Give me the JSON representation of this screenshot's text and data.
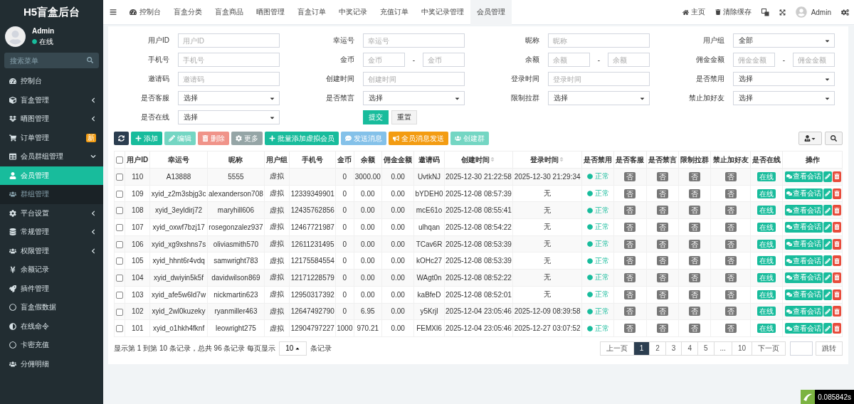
{
  "sidebar": {
    "brand": "H5盲盒后台",
    "user": {
      "name": "Admin",
      "status": "在线"
    },
    "search": {
      "placeholder": "搜索菜单"
    },
    "items": [
      {
        "label": "控制台",
        "selected": false
      },
      {
        "label": "盲盒管理",
        "selected": false,
        "expanded": false
      },
      {
        "label": "晒图管理",
        "selected": false,
        "expanded": false
      },
      {
        "label": "订单管理",
        "selected": false,
        "badge": "新"
      },
      {
        "label": "会员群组管理",
        "selected": false,
        "expanded": true,
        "children": [
          {
            "label": "会员管理",
            "selected": true
          },
          {
            "label": "群组管理",
            "selected": false
          }
        ]
      },
      {
        "label": "平台设置",
        "selected": false,
        "expanded": false
      },
      {
        "label": "常规管理",
        "selected": false,
        "expanded": false
      },
      {
        "label": "权限管理",
        "selected": false,
        "expanded": false
      },
      {
        "label": "余额记录",
        "selected": false
      },
      {
        "label": "插件管理",
        "selected": false
      },
      {
        "label": "盲盒假数据",
        "selected": false
      },
      {
        "label": "在线命令",
        "selected": false
      },
      {
        "label": "卡密充值",
        "selected": false
      },
      {
        "label": "分佣明细",
        "selected": false
      }
    ]
  },
  "topbar": {
    "tabs": [
      {
        "label": "控制台",
        "selected": false
      },
      {
        "label": "盲盒分类",
        "selected": false
      },
      {
        "label": "盲盒商品",
        "selected": false
      },
      {
        "label": "晒图管理",
        "selected": false
      },
      {
        "label": "盲盒订单",
        "selected": false
      },
      {
        "label": "中奖记录",
        "selected": false
      },
      {
        "label": "充值订单",
        "selected": false
      },
      {
        "label": "中奖记录管理",
        "selected": false
      },
      {
        "label": "会员管理",
        "selected": true
      }
    ],
    "links": [
      "主页",
      "清除缓存"
    ],
    "user": "Admin"
  },
  "filters": [
    {
      "label": "用户ID",
      "kind": "text",
      "placeholder": "用户ID"
    },
    {
      "label": "幸运号",
      "kind": "text",
      "placeholder": "幸运号"
    },
    {
      "label": "昵称",
      "kind": "text",
      "placeholder": "昵称"
    },
    {
      "label": "用户组",
      "kind": "select",
      "value": "全部"
    },
    {
      "label": "手机号",
      "kind": "text",
      "placeholder": "手机号"
    },
    {
      "label": "金币",
      "kind": "range",
      "placeholder": "金币",
      "placeholder_to": "金币",
      "separator": "-"
    },
    {
      "label": "余额",
      "kind": "range",
      "placeholder": "余额",
      "placeholder_to": "余额",
      "separator": "-"
    },
    {
      "label": "佣金金额",
      "kind": "range",
      "placeholder": "佣金金额",
      "placeholder_to": "佣金金额",
      "separator": "-"
    },
    {
      "label": "邀请码",
      "kind": "text",
      "placeholder": "邀请码"
    },
    {
      "label": "创建时间",
      "kind": "text",
      "placeholder": "创建时间"
    },
    {
      "label": "登录时间",
      "kind": "text",
      "placeholder": "登录时间"
    },
    {
      "label": "是否禁用",
      "kind": "select",
      "value": "选择"
    },
    {
      "label": "是否客服",
      "kind": "select",
      "value": "选择"
    },
    {
      "label": "是否禁言",
      "kind": "select",
      "value": "选择"
    },
    {
      "label": "限制拉群",
      "kind": "select",
      "value": "选择"
    },
    {
      "label": "禁止加好友",
      "kind": "select",
      "value": "选择"
    },
    {
      "label": "是否在线",
      "kind": "select",
      "value": "选择"
    }
  ],
  "form_buttons": [
    "提交",
    "重置"
  ],
  "toolbar": [
    {
      "kind": "dark",
      "disabled": false
    },
    {
      "label": "添加",
      "kind": "success",
      "disabled": false
    },
    {
      "label": "编辑",
      "kind": "success",
      "disabled": true
    },
    {
      "label": "删除",
      "kind": "danger",
      "disabled": true
    },
    {
      "label": "更多",
      "kind": "muted",
      "disabled": false
    },
    {
      "label": "批量添加虚拟会员",
      "kind": "success",
      "disabled": false
    },
    {
      "label": "发送消息",
      "kind": "info",
      "disabled": true
    },
    {
      "label": "全员消息发送",
      "kind": "warning",
      "disabled": false
    },
    {
      "label": "创建群",
      "kind": "success",
      "disabled": true
    }
  ],
  "table": {
    "select_all_checked": false,
    "columns": [
      {
        "label": "用户ID",
        "sortable": false
      },
      {
        "label": "幸运号",
        "sortable": false
      },
      {
        "label": "昵称",
        "sortable": false
      },
      {
        "label": "用户组",
        "sortable": false
      },
      {
        "label": "手机号",
        "sortable": false
      },
      {
        "label": "金币",
        "sortable": false
      },
      {
        "label": "余额",
        "sortable": false
      },
      {
        "label": "佣金金额",
        "sortable": false
      },
      {
        "label": "邀请码",
        "sortable": false
      },
      {
        "label": "创建时间",
        "sortable": true
      },
      {
        "label": "登录时间",
        "sortable": true
      },
      {
        "label": "是否禁用",
        "sortable": false
      },
      {
        "label": "是否客服",
        "sortable": false
      },
      {
        "label": "是否禁言",
        "sortable": false
      },
      {
        "label": "限制拉群",
        "sortable": false
      },
      {
        "label": "禁止加好友",
        "sortable": false
      },
      {
        "label": "是否在线",
        "sortable": false
      },
      {
        "label": "操作",
        "sortable": false
      }
    ],
    "rows": [
      {
        "checked": false,
        "cells": [
          "110",
          "A13888",
          "5555",
          "虚拟",
          "",
          "0",
          "3000.00",
          "0.00",
          "UvtkNJ",
          "2025-12-30 21:22:58",
          "2025-12-30 21:29:34"
        ],
        "status": "正常",
        "flags": [
          "否",
          "否",
          "否",
          "否"
        ],
        "online": "在线",
        "action": "查看会话"
      },
      {
        "checked": false,
        "cells": [
          "109",
          "xyid_z2m3sbjg3c",
          "alexanderson708",
          "虚拟",
          "12339349901",
          "0",
          "0.00",
          "0.00",
          "bYDEH0",
          "2025-12-08 08:57:39",
          "无"
        ],
        "status": "正常",
        "flags": [
          "否",
          "否",
          "否",
          "否"
        ],
        "online": "在线",
        "action": "查看会话"
      },
      {
        "checked": false,
        "cells": [
          "108",
          "xyid_3eyldirj72",
          "maryhill606",
          "虚拟",
          "12435762856",
          "0",
          "0.00",
          "0.00",
          "mcE61o",
          "2025-12-08 08:55:41",
          "无"
        ],
        "status": "正常",
        "flags": [
          "否",
          "否",
          "否",
          "否"
        ],
        "online": "在线",
        "action": "查看会话"
      },
      {
        "checked": false,
        "cells": [
          "107",
          "xyid_oxwf7bzj17",
          "rosegonzalez937",
          "虚拟",
          "12467721987",
          "0",
          "0.00",
          "0.00",
          "ulhqan",
          "2025-12-08 08:54:22",
          "无"
        ],
        "status": "正常",
        "flags": [
          "否",
          "否",
          "否",
          "否"
        ],
        "online": "在线",
        "action": "查看会话"
      },
      {
        "checked": false,
        "cells": [
          "106",
          "xyid_xg9xshns7s",
          "oliviasmith570",
          "虚拟",
          "12611231495",
          "0",
          "0.00",
          "0.00",
          "TCav6R",
          "2025-12-08 08:53:39",
          "无"
        ],
        "status": "正常",
        "flags": [
          "否",
          "否",
          "否",
          "否"
        ],
        "online": "在线",
        "action": "查看会话"
      },
      {
        "checked": false,
        "cells": [
          "105",
          "xyid_hhnt6r4vdq",
          "samwright783",
          "虚拟",
          "12175584554",
          "0",
          "0.00",
          "0.00",
          "kOHc27",
          "2025-12-08 08:53:39",
          "无"
        ],
        "status": "正常",
        "flags": [
          "否",
          "否",
          "否",
          "否"
        ],
        "online": "在线",
        "action": "查看会话"
      },
      {
        "checked": false,
        "cells": [
          "104",
          "xyid_dwiyin5k5f",
          "davidwilson869",
          "虚拟",
          "12171228579",
          "0",
          "0.00",
          "0.00",
          "WAgt0n",
          "2025-12-08 08:52:22",
          "无"
        ],
        "status": "正常",
        "flags": [
          "否",
          "否",
          "否",
          "否"
        ],
        "online": "在线",
        "action": "查看会话"
      },
      {
        "checked": false,
        "cells": [
          "103",
          "xyid_afe5w6ld7w",
          "nickmartin623",
          "虚拟",
          "12950317392",
          "0",
          "0.00",
          "0.00",
          "kaBfeD",
          "2025-12-08 08:52:01",
          "无"
        ],
        "status": "正常",
        "flags": [
          "否",
          "否",
          "否",
          "否"
        ],
        "online": "在线",
        "action": "查看会话"
      },
      {
        "checked": false,
        "cells": [
          "102",
          "xyid_2wl0kuzeky",
          "ryanmiller463",
          "虚拟",
          "12647492790",
          "0",
          "6.95",
          "0.00",
          "y5Krjl",
          "2025-12-04 23:05:46",
          "2025-12-09 08:39:58"
        ],
        "status": "正常",
        "flags": [
          "否",
          "否",
          "否",
          "否"
        ],
        "online": "在线",
        "action": "查看会话"
      },
      {
        "checked": false,
        "cells": [
          "101",
          "xyid_o1hkh4fknf",
          "leowright275",
          "虚拟",
          "12904797227",
          "1000",
          "970.21",
          "0.00",
          "FEMXl6",
          "2025-12-04 23:05:46",
          "2025-12-27 03:07:52"
        ],
        "status": "正常",
        "flags": [
          "否",
          "否",
          "否",
          "否"
        ],
        "online": "在线",
        "action": "查看会话"
      }
    ]
  },
  "footer": {
    "summary": "显示第 1 到第 10 条记录，总共 96 条记录 每页显示",
    "page_size": "10",
    "suffix": "条记录"
  },
  "pagination": {
    "prev": "上一页",
    "next": "下一页",
    "pages": [
      {
        "label": "1",
        "selected": true
      },
      {
        "label": "2",
        "selected": false
      },
      {
        "label": "3",
        "selected": false
      },
      {
        "label": "4",
        "selected": false
      },
      {
        "label": "5",
        "selected": false
      },
      {
        "label": "...",
        "selected": false
      },
      {
        "label": "10",
        "selected": false
      }
    ],
    "jump": "跳转"
  },
  "debug_time": "0.085842s"
}
